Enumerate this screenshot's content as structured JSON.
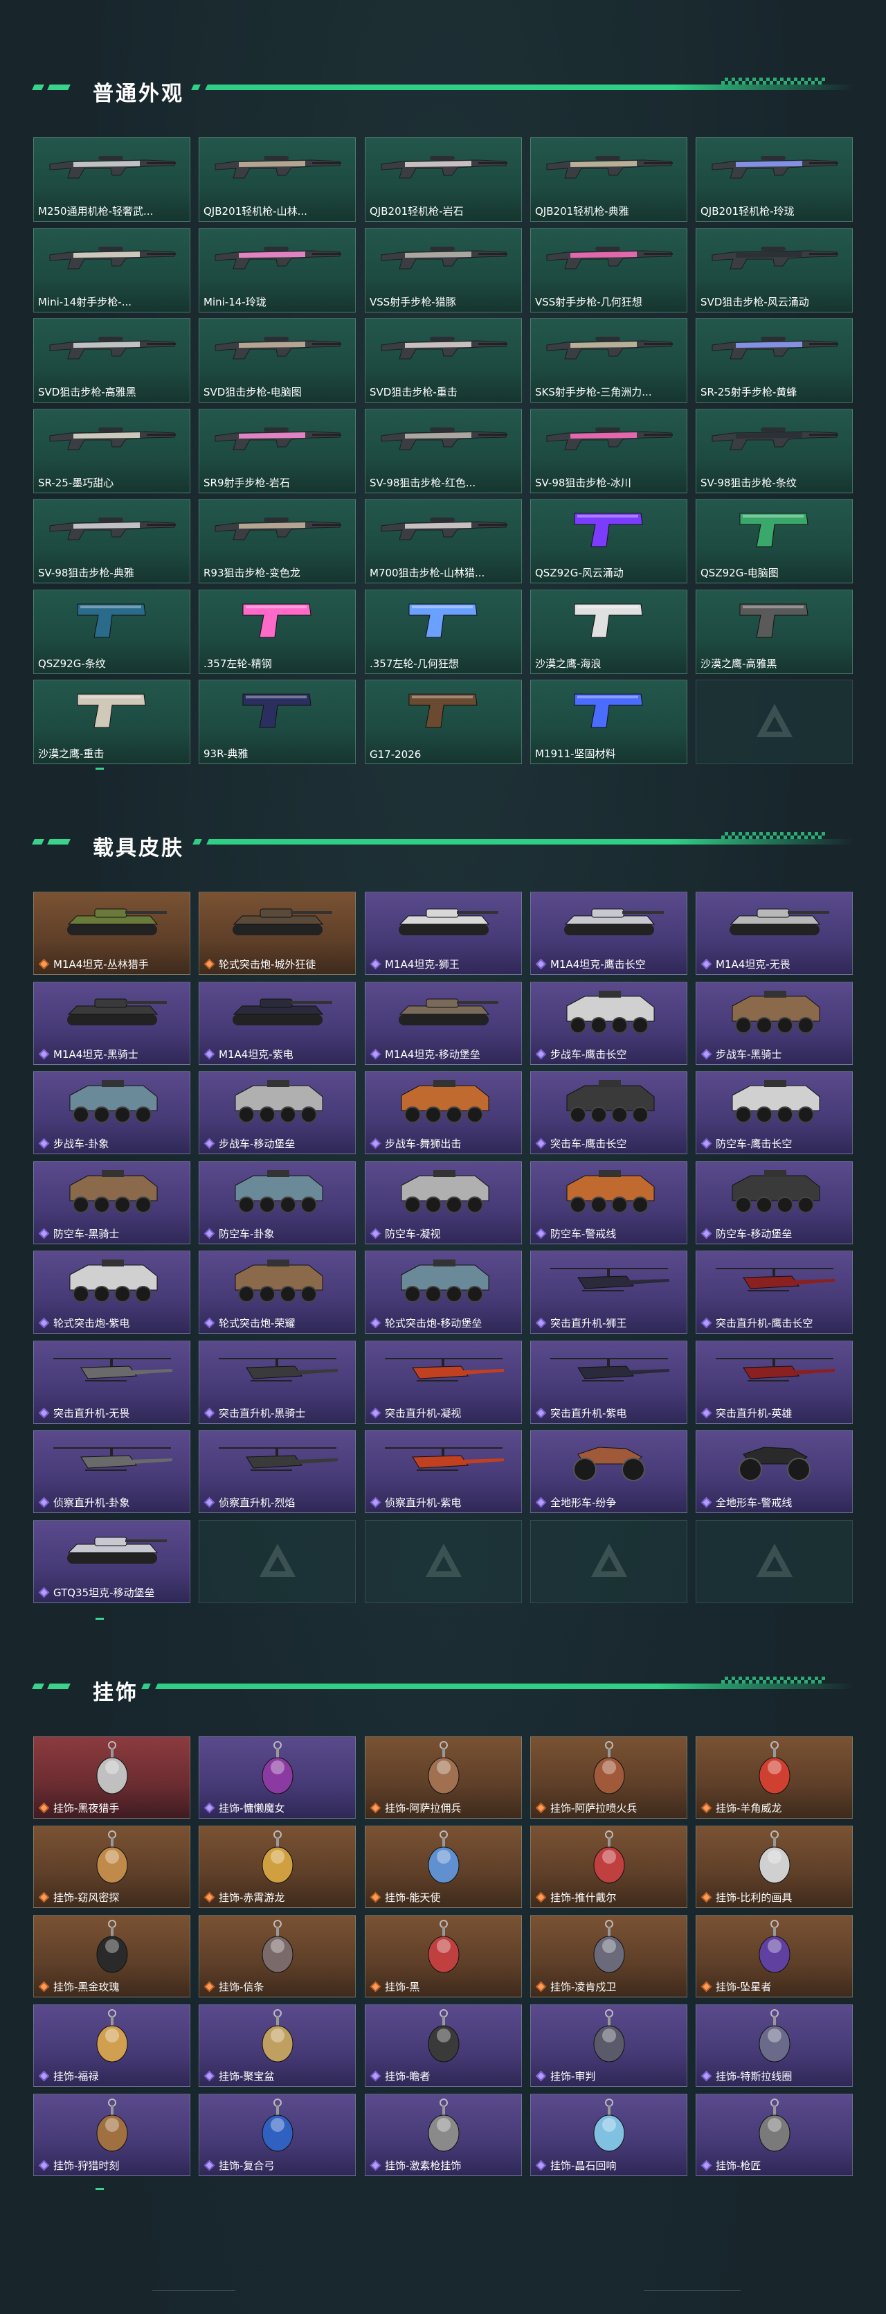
{
  "sections": [
    {
      "title": "普通外观",
      "items": [
        "M250通用机枪-轻奢武...",
        "QJB201轻机枪-山林...",
        "QJB201轻机枪-岩石",
        "QJB201轻机枪-典雅",
        "QJB201轻机枪-玲珑",
        "Mini-14射手步枪-...",
        "Mini-14-玲珑",
        "VSS射手步枪-猎豚",
        "VSS射手步枪-几何狂想",
        "SVD狙击步枪-风云涌动",
        "SVD狙击步枪-高雅黑",
        "SVD狙击步枪-电脑图",
        "SVD狙击步枪-重击",
        "SKS射手步枪-三角洲力...",
        "SR-25射手步枪-黄蜂",
        "SR-25-墨巧甜心",
        "SR9射手步枪-岩石",
        "SV-98狙击步枪-红色...",
        "SV-98狙击步枪-冰川",
        "SV-98狙击步枪-条纹",
        "SV-98狙击步枪-典雅",
        "R93狙击步枪-变色龙",
        "M700狙击步枪-山林猎...",
        "QSZ92G-风云涌动",
        "QSZ92G-电脑图",
        "QSZ92G-条纹",
        ".357左轮-精钢",
        ".357左轮-几何狂想",
        "沙漠之鹰-海浪",
        "沙漠之鹰-高雅黑",
        "沙漠之鹰-重击",
        "93R-典雅",
        "G17-2026",
        "M1911-坚固材料",
        ""
      ]
    },
    {
      "title": "载具皮肤",
      "items": [
        "M1A4坦克-丛林猎手",
        "轮式突击炮-城外狂徒",
        "M1A4坦克-狮王",
        "M1A4坦克-鹰击长空",
        "M1A4坦克-无畏",
        "M1A4坦克-黑骑士",
        "M1A4坦克-紫电",
        "M1A4坦克-移动堡垒",
        "步战车-鹰击长空",
        "步战车-黑骑士",
        "步战车-卦象",
        "步战车-移动堡垒",
        "步战车-舞狮出击",
        "突击车-鹰击长空",
        "防空车-鹰击长空",
        "防空车-黑骑士",
        "防空车-卦象",
        "防空车-凝视",
        "防空车-警戒线",
        "防空车-移动堡垒",
        "轮式突击炮-紫电",
        "轮式突击炮-荣耀",
        "轮式突击炮-移动堡垒",
        "突击直升机-狮王",
        "突击直升机-鹰击长空",
        "突击直升机-无畏",
        "突击直升机-黑骑士",
        "突击直升机-凝视",
        "突击直升机-紫电",
        "突击直升机-英雄",
        "侦察直升机-卦象",
        "侦察直升机-烈焰",
        "侦察直升机-紫电",
        "全地形车-纷争",
        "全地形车-警戒线",
        "GTQ35坦克-移动堡垒",
        "",
        "",
        "",
        ""
      ]
    },
    {
      "title": "挂饰",
      "items": [
        "挂饰-黑夜猎手",
        "挂饰-慵懒魔女",
        "挂饰-阿萨拉佣兵",
        "挂饰-阿萨拉喷火兵",
        "挂饰-羊角威龙",
        "挂饰-窈风密探",
        "挂饰-赤霄游龙",
        "挂饰-能天使",
        "挂饰-推什戴尔",
        "挂饰-比利的画具",
        "挂饰-黑金玫瑰",
        "挂饰-信条",
        "挂饰-黑",
        "挂饰-凌肯戍卫",
        "挂饰-坠星者",
        "挂饰-福禄",
        "挂饰-聚宝盆",
        "挂饰-瞻者",
        "挂饰-审判",
        "挂饰-特斯拉线圈",
        "挂饰-狩猎时刻",
        "挂饰-复合弓",
        "挂饰-激素枪挂饰",
        "挂饰-晶石回响",
        "挂饰-枪匠"
      ]
    }
  ],
  "colors": {
    "accent": "#2fcf86",
    "card_green": "#23574c",
    "card_orange": "#7a5233",
    "card_purple": "#5a4a8c",
    "card_red": "#8c3b3f"
  }
}
